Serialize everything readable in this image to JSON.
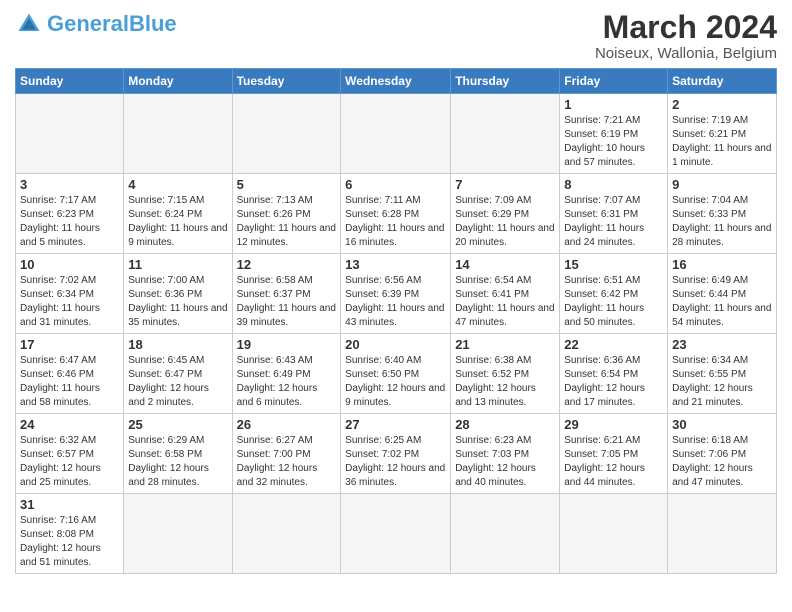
{
  "header": {
    "logo_general": "General",
    "logo_blue": "Blue",
    "month_year": "March 2024",
    "location": "Noiseux, Wallonia, Belgium"
  },
  "days_of_week": [
    "Sunday",
    "Monday",
    "Tuesday",
    "Wednesday",
    "Thursday",
    "Friday",
    "Saturday"
  ],
  "weeks": [
    {
      "days": [
        {
          "num": "",
          "info": "",
          "empty": true
        },
        {
          "num": "",
          "info": "",
          "empty": true
        },
        {
          "num": "",
          "info": "",
          "empty": true
        },
        {
          "num": "",
          "info": "",
          "empty": true
        },
        {
          "num": "",
          "info": "",
          "empty": true
        },
        {
          "num": "1",
          "info": "Sunrise: 7:21 AM\nSunset: 6:19 PM\nDaylight: 10 hours and 57 minutes."
        },
        {
          "num": "2",
          "info": "Sunrise: 7:19 AM\nSunset: 6:21 PM\nDaylight: 11 hours and 1 minute."
        }
      ]
    },
    {
      "days": [
        {
          "num": "3",
          "info": "Sunrise: 7:17 AM\nSunset: 6:23 PM\nDaylight: 11 hours and 5 minutes."
        },
        {
          "num": "4",
          "info": "Sunrise: 7:15 AM\nSunset: 6:24 PM\nDaylight: 11 hours and 9 minutes."
        },
        {
          "num": "5",
          "info": "Sunrise: 7:13 AM\nSunset: 6:26 PM\nDaylight: 11 hours and 12 minutes."
        },
        {
          "num": "6",
          "info": "Sunrise: 7:11 AM\nSunset: 6:28 PM\nDaylight: 11 hours and 16 minutes."
        },
        {
          "num": "7",
          "info": "Sunrise: 7:09 AM\nSunset: 6:29 PM\nDaylight: 11 hours and 20 minutes."
        },
        {
          "num": "8",
          "info": "Sunrise: 7:07 AM\nSunset: 6:31 PM\nDaylight: 11 hours and 24 minutes."
        },
        {
          "num": "9",
          "info": "Sunrise: 7:04 AM\nSunset: 6:33 PM\nDaylight: 11 hours and 28 minutes."
        }
      ]
    },
    {
      "days": [
        {
          "num": "10",
          "info": "Sunrise: 7:02 AM\nSunset: 6:34 PM\nDaylight: 11 hours and 31 minutes."
        },
        {
          "num": "11",
          "info": "Sunrise: 7:00 AM\nSunset: 6:36 PM\nDaylight: 11 hours and 35 minutes."
        },
        {
          "num": "12",
          "info": "Sunrise: 6:58 AM\nSunset: 6:37 PM\nDaylight: 11 hours and 39 minutes."
        },
        {
          "num": "13",
          "info": "Sunrise: 6:56 AM\nSunset: 6:39 PM\nDaylight: 11 hours and 43 minutes."
        },
        {
          "num": "14",
          "info": "Sunrise: 6:54 AM\nSunset: 6:41 PM\nDaylight: 11 hours and 47 minutes."
        },
        {
          "num": "15",
          "info": "Sunrise: 6:51 AM\nSunset: 6:42 PM\nDaylight: 11 hours and 50 minutes."
        },
        {
          "num": "16",
          "info": "Sunrise: 6:49 AM\nSunset: 6:44 PM\nDaylight: 11 hours and 54 minutes."
        }
      ]
    },
    {
      "days": [
        {
          "num": "17",
          "info": "Sunrise: 6:47 AM\nSunset: 6:46 PM\nDaylight: 11 hours and 58 minutes."
        },
        {
          "num": "18",
          "info": "Sunrise: 6:45 AM\nSunset: 6:47 PM\nDaylight: 12 hours and 2 minutes."
        },
        {
          "num": "19",
          "info": "Sunrise: 6:43 AM\nSunset: 6:49 PM\nDaylight: 12 hours and 6 minutes."
        },
        {
          "num": "20",
          "info": "Sunrise: 6:40 AM\nSunset: 6:50 PM\nDaylight: 12 hours and 9 minutes."
        },
        {
          "num": "21",
          "info": "Sunrise: 6:38 AM\nSunset: 6:52 PM\nDaylight: 12 hours and 13 minutes."
        },
        {
          "num": "22",
          "info": "Sunrise: 6:36 AM\nSunset: 6:54 PM\nDaylight: 12 hours and 17 minutes."
        },
        {
          "num": "23",
          "info": "Sunrise: 6:34 AM\nSunset: 6:55 PM\nDaylight: 12 hours and 21 minutes."
        }
      ]
    },
    {
      "days": [
        {
          "num": "24",
          "info": "Sunrise: 6:32 AM\nSunset: 6:57 PM\nDaylight: 12 hours and 25 minutes."
        },
        {
          "num": "25",
          "info": "Sunrise: 6:29 AM\nSunset: 6:58 PM\nDaylight: 12 hours and 28 minutes."
        },
        {
          "num": "26",
          "info": "Sunrise: 6:27 AM\nSunset: 7:00 PM\nDaylight: 12 hours and 32 minutes."
        },
        {
          "num": "27",
          "info": "Sunrise: 6:25 AM\nSunset: 7:02 PM\nDaylight: 12 hours and 36 minutes."
        },
        {
          "num": "28",
          "info": "Sunrise: 6:23 AM\nSunset: 7:03 PM\nDaylight: 12 hours and 40 minutes."
        },
        {
          "num": "29",
          "info": "Sunrise: 6:21 AM\nSunset: 7:05 PM\nDaylight: 12 hours and 44 minutes."
        },
        {
          "num": "30",
          "info": "Sunrise: 6:18 AM\nSunset: 7:06 PM\nDaylight: 12 hours and 47 minutes."
        }
      ]
    },
    {
      "days": [
        {
          "num": "31",
          "info": "Sunrise: 7:16 AM\nSunset: 8:08 PM\nDaylight: 12 hours and 51 minutes."
        },
        {
          "num": "",
          "info": "",
          "empty": true
        },
        {
          "num": "",
          "info": "",
          "empty": true
        },
        {
          "num": "",
          "info": "",
          "empty": true
        },
        {
          "num": "",
          "info": "",
          "empty": true
        },
        {
          "num": "",
          "info": "",
          "empty": true
        },
        {
          "num": "",
          "info": "",
          "empty": true
        }
      ]
    }
  ]
}
